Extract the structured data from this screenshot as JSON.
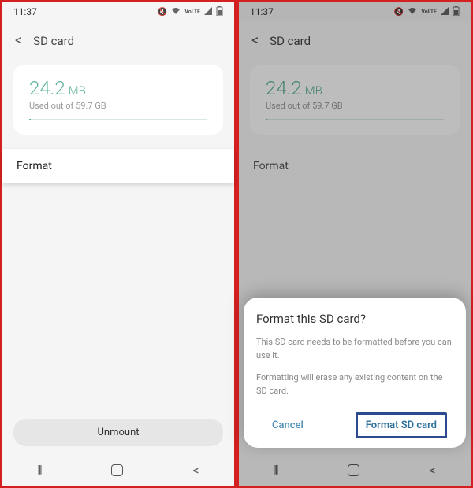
{
  "statusbar": {
    "time": "11:37",
    "icons_text": "VoLTE"
  },
  "header": {
    "title": "SD card"
  },
  "storage": {
    "value": "24.2",
    "unit": "MB",
    "subtext": "Used out of 59.7 GB"
  },
  "list": {
    "format_label": "Format",
    "unmount_label": "Unmount"
  },
  "dialog": {
    "title": "Format this SD card?",
    "line1": "This SD card needs to be formatted before you can use it.",
    "line2": "Formatting will erase any existing content on the SD card.",
    "cancel": "Cancel",
    "confirm": "Format SD card"
  }
}
